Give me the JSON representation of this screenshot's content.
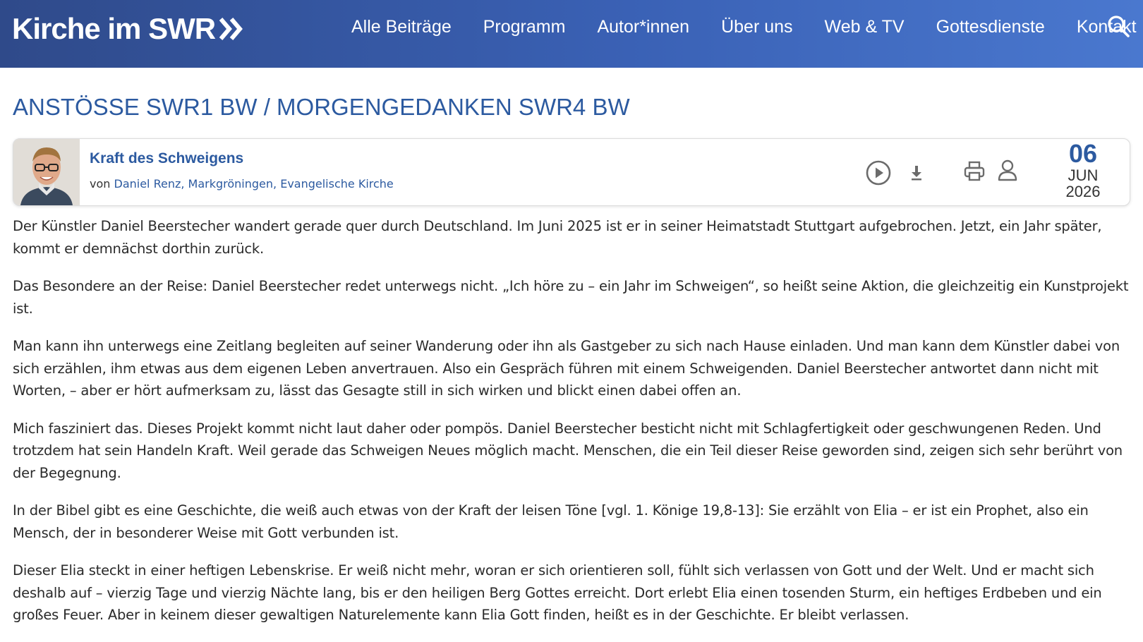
{
  "header": {
    "brand": "Kirche im SWR",
    "nav": [
      "Alle Beiträge",
      "Programm",
      "Autor*innen",
      "Über uns",
      "Web & TV",
      "Gottesdienste",
      "Kontakt"
    ],
    "colors": {
      "bar_start": "#2f4a8a",
      "bar_end": "#4a78cf",
      "accent": "#2c5aa0"
    }
  },
  "section_title": "ANSTÖSSE SWR1 BW / MORGENGEDANKEN SWR4 BW",
  "card": {
    "title": "Kraft des Schweigens",
    "by_prefix": "von",
    "author_link": "Daniel Renz, Markgröningen, Evangelische Kirche",
    "icons": [
      "play-icon",
      "download-icon",
      "print-icon",
      "person-icon"
    ],
    "date": {
      "day": "06",
      "month": "JUN",
      "year": "2026"
    }
  },
  "article": {
    "paragraphs": [
      "Der Künstler Daniel Beerstecher wandert gerade quer durch Deutschland. Im Juni 2025 ist er in seiner Heimatstadt Stuttgart aufgebrochen. Jetzt, ein Jahr später, kommt er demnächst dorthin zurück.",
      "Das Besondere an der Reise: Daniel Beerstecher redet unterwegs nicht. „Ich höre zu – ein Jahr im Schweigen“, so heißt seine Aktion, die gleichzeitig ein Kunstprojekt ist.",
      "Man kann ihn unterwegs eine Zeitlang begleiten auf seiner Wanderung oder ihn als Gastgeber zu sich nach Hause einladen. Und man kann dem Künstler dabei von sich erzählen, ihm etwas aus dem eigenen Leben anvertrauen. Also ein Gespräch führen mit einem Schweigenden. Daniel Beerstecher antwortet dann nicht mit Worten, – aber er hört aufmerksam zu, lässt das Gesagte still in sich wirken und blickt einen dabei offen an.",
      "Mich fasziniert das. Dieses Projekt kommt nicht laut daher oder pompös. Daniel Beerstecher besticht nicht mit Schlagfertigkeit oder geschwungenen Reden. Und trotzdem hat sein Handeln Kraft. Weil gerade das Schweigen Neues möglich macht. Menschen, die ein Teil dieser Reise geworden sind, zeigen sich sehr berührt von der Begegnung.",
      "In der Bibel gibt es eine Geschichte, die weiß auch etwas von der Kraft der leisen Töne [vgl. 1. Könige 19,8-13]: Sie erzählt von Elia – er ist ein Prophet, also ein Mensch, der in besonderer Weise mit Gott verbunden ist.",
      "Dieser Elia steckt in einer heftigen Lebenskrise. Er weiß nicht mehr, woran er sich orientieren soll, fühlt sich verlassen von Gott und der Welt. Und er macht sich deshalb auf – vierzig Tage und vierzig Nächte lang, bis er den heiligen Berg Gottes erreicht. Dort erlebt Elia einen tosenden Sturm, ein heftiges Erdbeben und ein großes Feuer. Aber in keinem dieser gewaltigen Naturelemente kann Elia Gott finden, heißt es in der Geschichte. Er bleibt verlassen."
    ]
  }
}
